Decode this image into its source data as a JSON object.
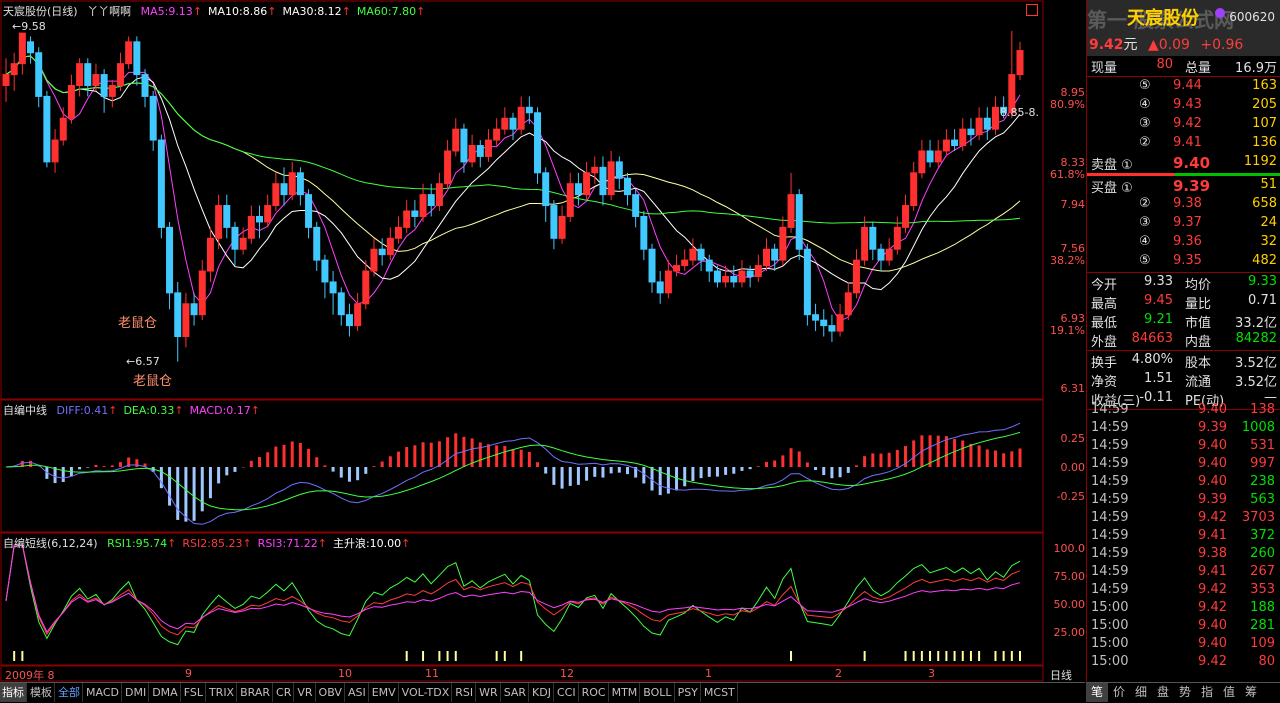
{
  "stock": {
    "name": "天宸股份",
    "code": "600620",
    "period": "日线",
    "extra_title": "丫丫啊啊",
    "price": "9.42",
    "unit": "元",
    "change": "▲0.09",
    "change_pct": "+0.96"
  },
  "watermark": "第一 股票公式网",
  "main_indicators": [
    {
      "label": "MA5:9.13",
      "color": "#ff40ff"
    },
    {
      "label": "MA10:8.86",
      "color": "#ffffff"
    },
    {
      "label": "MA30:8.12",
      "color": "#ffffff"
    },
    {
      "label": "MA60:7.80",
      "color": "#40ff40"
    }
  ],
  "main_axis": {
    "price_labels": [
      "8.95",
      "8.33",
      "7.94",
      "7.56",
      "6.93",
      "6.31"
    ],
    "pct_labels": [
      "80.9%",
      "61.8%",
      "38.2%",
      "19.1%"
    ]
  },
  "annotations": {
    "high": "9.58",
    "low": "6.57",
    "low_text_1": "老鼠仓",
    "low_text_2": "老鼠仓",
    "right_label": "8.85-8."
  },
  "macd_panel": {
    "title": "自编中线",
    "items": [
      {
        "label": "DIFF:0.41",
        "color": "#7070ff"
      },
      {
        "label": "DEA:0.33",
        "color": "#40ff40"
      },
      {
        "label": "MACD:0.17",
        "color": "#ff40ff"
      }
    ],
    "axis": [
      "0.25",
      "0.00",
      "-0.25"
    ]
  },
  "rsi_panel": {
    "title": "自编短线(6,12,24)",
    "items": [
      {
        "label": "RSI1:95.74",
        "color": "#40ff40"
      },
      {
        "label": "RSI2:85.23",
        "color": "#ff3b3b"
      },
      {
        "label": "RSI3:71.22",
        "color": "#ff40ff"
      },
      {
        "label": "主升浪:10.00",
        "color": "#ffffff"
      }
    ],
    "axis": [
      "100.0",
      "75.00",
      "50.00",
      "25.00"
    ]
  },
  "time_axis": {
    "labels": [
      "2009年 8",
      "9",
      "10",
      "11",
      "12",
      "1",
      "2",
      "3"
    ],
    "period_tab": "日线"
  },
  "quote": {
    "volume_now": {
      "label": "现量",
      "value": "80",
      "label2": "总量",
      "value2": "16.9万"
    },
    "sells": [
      {
        "label": "⑤",
        "price": "9.44",
        "vol": "163"
      },
      {
        "label": "④",
        "price": "9.43",
        "vol": "205"
      },
      {
        "label": "③",
        "price": "9.42",
        "vol": "107"
      },
      {
        "label": "②",
        "price": "9.41",
        "vol": "136"
      },
      {
        "label": "卖盘 ①",
        "price": "9.40",
        "vol": "1192"
      }
    ],
    "buys": [
      {
        "label": "买盘 ①",
        "price": "9.39",
        "vol": "51"
      },
      {
        "label": "②",
        "price": "9.38",
        "vol": "658"
      },
      {
        "label": "③",
        "price": "9.37",
        "vol": "24"
      },
      {
        "label": "④",
        "price": "9.36",
        "vol": "32"
      },
      {
        "label": "⑤",
        "price": "9.35",
        "vol": "482"
      }
    ],
    "stats1": [
      {
        "l1": "今开",
        "v1": "9.33",
        "c1": "#e0e0e0",
        "l2": "均价",
        "v2": "9.33",
        "c2": "#00e000"
      },
      {
        "l1": "最高",
        "v1": "9.45",
        "c1": "#ff3b3b",
        "l2": "量比",
        "v2": "0.71",
        "c2": "#e0e0e0"
      },
      {
        "l1": "最低",
        "v1": "9.21",
        "c1": "#00e000",
        "l2": "市值",
        "v2": "33.2亿",
        "c2": "#e0e0e0"
      },
      {
        "l1": "外盘",
        "v1": "84663",
        "c1": "#ff3b3b",
        "l2": "内盘",
        "v2": "84282",
        "c2": "#00e000"
      }
    ],
    "stats2": [
      {
        "l1": "换手",
        "v1": "4.80%",
        "l2": "股本",
        "v2": "3.52亿"
      },
      {
        "l1": "净资",
        "v1": "1.51",
        "l2": "流通",
        "v2": "3.52亿"
      },
      {
        "l1": "收益(三)",
        "v1": "-0.11",
        "l2": "PE(动)",
        "v2": "—"
      }
    ],
    "ticks": [
      {
        "t": "14:59",
        "p": "9.40",
        "v": "138",
        "vc": "#ff3b3b"
      },
      {
        "t": "14:59",
        "p": "9.39",
        "v": "1008",
        "vc": "#00e000"
      },
      {
        "t": "14:59",
        "p": "9.40",
        "v": "531",
        "vc": "#ff3b3b"
      },
      {
        "t": "14:59",
        "p": "9.40",
        "v": "997",
        "vc": "#ff3b3b"
      },
      {
        "t": "14:59",
        "p": "9.40",
        "v": "238",
        "vc": "#00e000"
      },
      {
        "t": "14:59",
        "p": "9.39",
        "v": "563",
        "vc": "#00e000"
      },
      {
        "t": "14:59",
        "p": "9.42",
        "v": "3703",
        "vc": "#ff3b3b"
      },
      {
        "t": "14:59",
        "p": "9.41",
        "v": "372",
        "vc": "#00e000"
      },
      {
        "t": "14:59",
        "p": "9.38",
        "v": "260",
        "vc": "#00e000"
      },
      {
        "t": "14:59",
        "p": "9.41",
        "v": "267",
        "vc": "#ff3b3b"
      },
      {
        "t": "14:59",
        "p": "9.42",
        "v": "353",
        "vc": "#ff3b3b"
      },
      {
        "t": "15:00",
        "p": "9.42",
        "v": "188",
        "vc": "#00e000"
      },
      {
        "t": "15:00",
        "p": "9.40",
        "v": "281",
        "vc": "#00e000"
      },
      {
        "t": "15:00",
        "p": "9.40",
        "v": "109",
        "vc": "#ff3b3b"
      },
      {
        "t": "15:00",
        "p": "9.42",
        "v": "80",
        "vc": "#ff3b3b"
      }
    ]
  },
  "bottom_tabs": [
    "指标",
    "模板",
    "全部",
    "MACD",
    "DMI",
    "DMA",
    "FSL",
    "TRIX",
    "BRAR",
    "CR",
    "VR",
    "OBV",
    "ASI",
    "EMV",
    "VOL-TDX",
    "RSI",
    "WR",
    "SAR",
    "KDJ",
    "CCI",
    "ROC",
    "MTM",
    "BOLL",
    "PSY",
    "MCST"
  ],
  "right_tabs": [
    "笔",
    "价",
    "细",
    "盘",
    "势",
    "指",
    "值",
    "筹"
  ],
  "candles": [
    [
      9.1,
      9.2,
      9.35,
      8.95
    ],
    [
      9.2,
      9.3,
      9.4,
      9.05
    ],
    [
      9.3,
      9.58,
      9.58,
      9.2
    ],
    [
      9.5,
      9.4,
      9.55,
      9.3
    ],
    [
      9.4,
      9.0,
      9.45,
      8.9
    ],
    [
      9.0,
      8.4,
      9.05,
      8.35
    ],
    [
      8.4,
      8.6,
      8.7,
      8.3
    ],
    [
      8.6,
      8.8,
      8.9,
      8.55
    ],
    [
      8.8,
      9.1,
      9.2,
      8.75
    ],
    [
      9.1,
      9.3,
      9.35,
      9.0
    ],
    [
      9.3,
      9.1,
      9.35,
      9.0
    ],
    [
      9.1,
      9.2,
      9.3,
      9.05
    ],
    [
      9.2,
      9.0,
      9.25,
      8.85
    ],
    [
      9.0,
      9.1,
      9.15,
      8.9
    ],
    [
      9.1,
      9.3,
      9.4,
      9.05
    ],
    [
      9.3,
      9.5,
      9.55,
      9.25
    ],
    [
      9.5,
      9.2,
      9.55,
      9.1
    ],
    [
      9.2,
      9.0,
      9.25,
      8.9
    ],
    [
      9.0,
      8.6,
      9.05,
      8.5
    ],
    [
      8.6,
      7.8,
      8.65,
      7.7
    ],
    [
      7.8,
      7.2,
      7.85,
      7.05
    ],
    [
      7.2,
      6.8,
      7.3,
      6.57
    ],
    [
      6.8,
      7.1,
      7.2,
      6.7
    ],
    [
      7.1,
      7.0,
      7.2,
      6.9
    ],
    [
      7.0,
      7.4,
      7.5,
      6.95
    ],
    [
      7.4,
      7.7,
      7.8,
      7.3
    ],
    [
      7.7,
      8.0,
      8.1,
      7.6
    ],
    [
      8.0,
      7.8,
      8.1,
      7.7
    ],
    [
      7.8,
      7.6,
      7.85,
      7.45
    ],
    [
      7.6,
      7.7,
      7.8,
      7.55
    ],
    [
      7.7,
      7.9,
      8.0,
      7.65
    ],
    [
      7.9,
      7.85,
      8.0,
      7.7
    ],
    [
      7.85,
      8.0,
      8.1,
      7.8
    ],
    [
      8.0,
      8.2,
      8.3,
      7.95
    ],
    [
      8.2,
      8.1,
      8.35,
      8.0
    ],
    [
      8.1,
      8.3,
      8.4,
      8.05
    ],
    [
      8.3,
      8.1,
      8.35,
      8.0
    ],
    [
      8.1,
      7.8,
      8.15,
      7.7
    ],
    [
      7.8,
      7.5,
      7.85,
      7.4
    ],
    [
      7.5,
      7.3,
      7.55,
      7.15
    ],
    [
      7.3,
      7.2,
      7.4,
      7.0
    ],
    [
      7.2,
      7.0,
      7.25,
      6.9
    ],
    [
      7.0,
      6.9,
      7.1,
      6.8
    ],
    [
      6.9,
      7.1,
      7.2,
      6.85
    ],
    [
      7.1,
      7.4,
      7.5,
      7.05
    ],
    [
      7.4,
      7.6,
      7.7,
      7.35
    ],
    [
      7.6,
      7.55,
      7.7,
      7.45
    ],
    [
      7.55,
      7.7,
      7.8,
      7.5
    ],
    [
      7.7,
      7.8,
      7.9,
      7.65
    ],
    [
      7.8,
      7.95,
      8.05,
      7.75
    ],
    [
      7.95,
      7.9,
      8.05,
      7.8
    ],
    [
      7.9,
      8.1,
      8.2,
      7.85
    ],
    [
      8.1,
      8.0,
      8.2,
      7.9
    ],
    [
      8.0,
      8.2,
      8.3,
      7.95
    ],
    [
      8.2,
      8.5,
      8.6,
      8.15
    ],
    [
      8.5,
      8.7,
      8.8,
      8.45
    ],
    [
      8.7,
      8.4,
      8.75,
      8.3
    ],
    [
      8.4,
      8.55,
      8.65,
      8.35
    ],
    [
      8.55,
      8.45,
      8.6,
      8.35
    ],
    [
      8.45,
      8.6,
      8.7,
      8.4
    ],
    [
      8.6,
      8.7,
      8.8,
      8.55
    ],
    [
      8.7,
      8.8,
      8.9,
      8.65
    ],
    [
      8.8,
      8.7,
      8.85,
      8.6
    ],
    [
      8.7,
      8.9,
      9.0,
      8.65
    ],
    [
      8.9,
      8.85,
      9.0,
      8.75
    ],
    [
      8.85,
      8.3,
      8.9,
      8.2
    ],
    [
      8.3,
      8.0,
      8.35,
      7.85
    ],
    [
      8.0,
      7.7,
      8.05,
      7.6
    ],
    [
      7.7,
      7.9,
      8.0,
      7.65
    ],
    [
      7.9,
      8.2,
      8.3,
      7.85
    ],
    [
      8.2,
      8.1,
      8.3,
      8.0
    ],
    [
      8.1,
      8.3,
      8.4,
      8.05
    ],
    [
      8.3,
      8.35,
      8.45,
      8.2
    ],
    [
      8.35,
      8.1,
      8.45,
      8.0
    ],
    [
      8.1,
      8.4,
      8.5,
      8.05
    ],
    [
      8.4,
      8.25,
      8.45,
      8.15
    ],
    [
      8.25,
      8.1,
      8.3,
      8.0
    ],
    [
      8.1,
      7.9,
      8.15,
      7.8
    ],
    [
      7.9,
      7.6,
      7.95,
      7.5
    ],
    [
      7.6,
      7.3,
      7.65,
      7.2
    ],
    [
      7.3,
      7.2,
      7.4,
      7.1
    ],
    [
      7.2,
      7.4,
      7.5,
      7.15
    ],
    [
      7.4,
      7.45,
      7.55,
      7.35
    ],
    [
      7.45,
      7.5,
      7.6,
      7.4
    ],
    [
      7.5,
      7.6,
      7.7,
      7.45
    ],
    [
      7.6,
      7.5,
      7.65,
      7.4
    ],
    [
      7.5,
      7.4,
      7.55,
      7.3
    ],
    [
      7.4,
      7.3,
      7.45,
      7.25
    ],
    [
      7.3,
      7.35,
      7.45,
      7.25
    ],
    [
      7.35,
      7.3,
      7.45,
      7.25
    ],
    [
      7.3,
      7.4,
      7.5,
      7.25
    ],
    [
      7.4,
      7.35,
      7.45,
      7.25
    ],
    [
      7.35,
      7.45,
      7.55,
      7.3
    ],
    [
      7.45,
      7.6,
      7.7,
      7.4
    ],
    [
      7.6,
      7.5,
      7.65,
      7.4
    ],
    [
      7.5,
      7.8,
      7.9,
      7.45
    ],
    [
      7.8,
      8.1,
      8.3,
      7.75
    ],
    [
      8.1,
      7.6,
      8.15,
      7.5
    ],
    [
      7.6,
      7.0,
      7.65,
      6.9
    ],
    [
      7.0,
      6.95,
      7.1,
      6.85
    ],
    [
      6.95,
      6.9,
      7.05,
      6.8
    ],
    [
      6.9,
      6.85,
      7.0,
      6.75
    ],
    [
      6.85,
      7.0,
      7.1,
      6.8
    ],
    [
      7.0,
      7.2,
      7.3,
      6.95
    ],
    [
      7.2,
      7.5,
      7.6,
      7.15
    ],
    [
      7.5,
      7.8,
      7.9,
      7.45
    ],
    [
      7.8,
      7.6,
      7.85,
      7.5
    ],
    [
      7.6,
      7.5,
      7.65,
      7.4
    ],
    [
      7.5,
      7.6,
      7.7,
      7.45
    ],
    [
      7.6,
      7.8,
      7.9,
      7.55
    ],
    [
      7.8,
      8.0,
      8.1,
      7.75
    ],
    [
      8.0,
      8.3,
      8.4,
      7.95
    ],
    [
      8.3,
      8.5,
      8.6,
      8.25
    ],
    [
      8.5,
      8.4,
      8.6,
      8.35
    ],
    [
      8.4,
      8.5,
      8.6,
      8.35
    ],
    [
      8.5,
      8.6,
      8.7,
      8.45
    ],
    [
      8.6,
      8.55,
      8.7,
      8.5
    ],
    [
      8.55,
      8.7,
      8.8,
      8.5
    ],
    [
      8.7,
      8.65,
      8.8,
      8.55
    ],
    [
      8.65,
      8.8,
      8.9,
      8.6
    ],
    [
      8.8,
      8.7,
      8.9,
      8.6
    ],
    [
      8.7,
      8.9,
      9.0,
      8.65
    ],
    [
      8.9,
      8.85,
      9.0,
      8.8
    ],
    [
      8.85,
      9.2,
      9.6,
      8.8
    ],
    [
      9.2,
      9.42,
      9.5,
      9.15
    ]
  ]
}
